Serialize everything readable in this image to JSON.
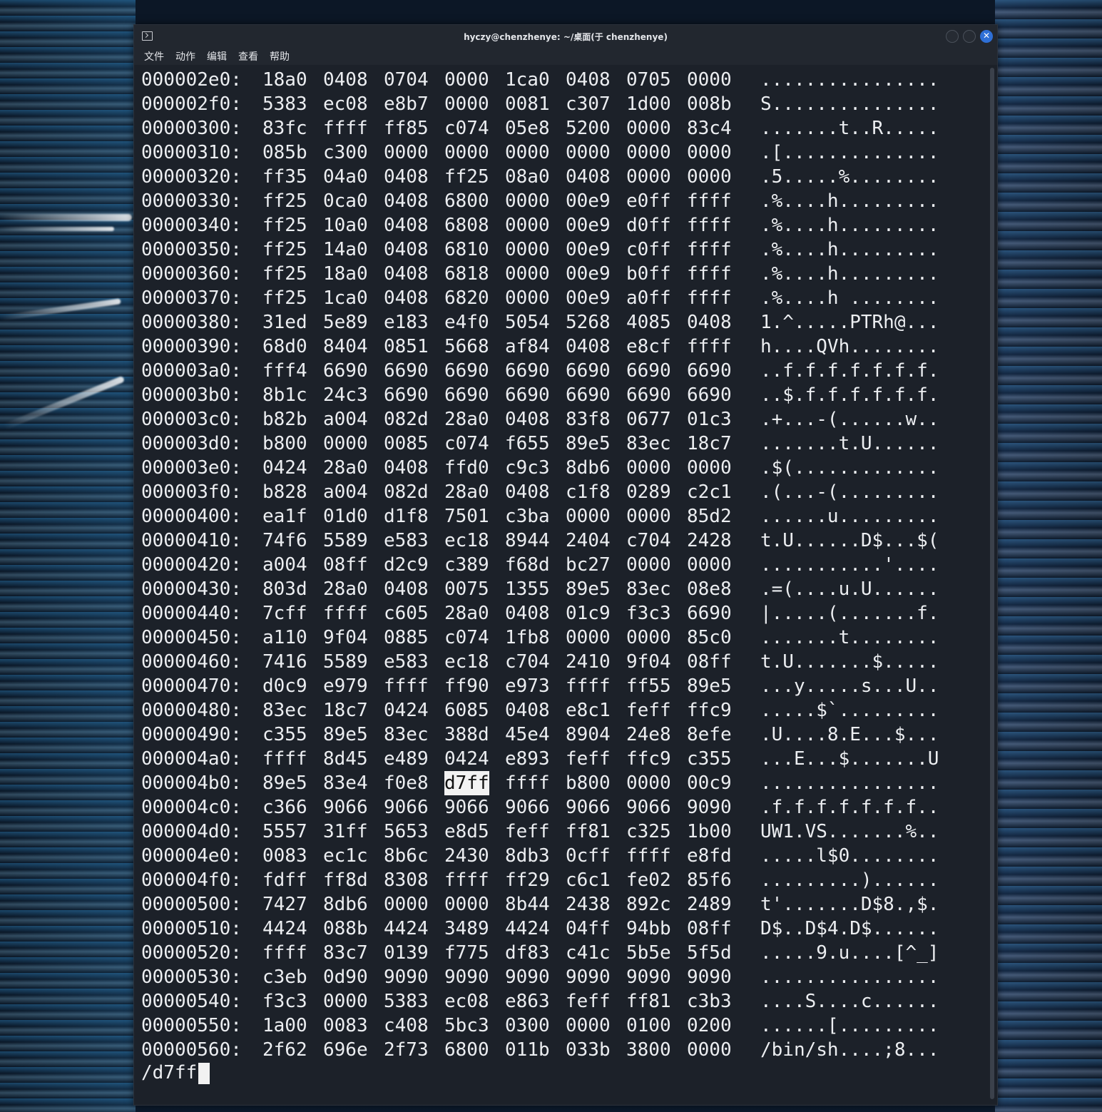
{
  "window": {
    "title": "hyczy@chenzhenye: ~/桌面(于 chenzhenye)",
    "close_glyph": "✕"
  },
  "menu": [
    "文件",
    "动作",
    "编辑",
    "查看",
    "帮助"
  ],
  "hexdump": [
    {
      "offset": "000002e0:",
      "words": [
        "18a0",
        "0408",
        "0704",
        "0000",
        "1ca0",
        "0408",
        "0705",
        "0000"
      ],
      "ascii": "................"
    },
    {
      "offset": "000002f0:",
      "words": [
        "5383",
        "ec08",
        "e8b7",
        "0000",
        "0081",
        "c307",
        "1d00",
        "008b"
      ],
      "ascii": "S..............."
    },
    {
      "offset": "00000300:",
      "words": [
        "83fc",
        "ffff",
        "ff85",
        "c074",
        "05e8",
        "5200",
        "0000",
        "83c4"
      ],
      "ascii": ".......t..R....."
    },
    {
      "offset": "00000310:",
      "words": [
        "085b",
        "c300",
        "0000",
        "0000",
        "0000",
        "0000",
        "0000",
        "0000"
      ],
      "ascii": ".[.............."
    },
    {
      "offset": "00000320:",
      "words": [
        "ff35",
        "04a0",
        "0408",
        "ff25",
        "08a0",
        "0408",
        "0000",
        "0000"
      ],
      "ascii": ".5.....%........"
    },
    {
      "offset": "00000330:",
      "words": [
        "ff25",
        "0ca0",
        "0408",
        "6800",
        "0000",
        "00e9",
        "e0ff",
        "ffff"
      ],
      "ascii": ".%....h........."
    },
    {
      "offset": "00000340:",
      "words": [
        "ff25",
        "10a0",
        "0408",
        "6808",
        "0000",
        "00e9",
        "d0ff",
        "ffff"
      ],
      "ascii": ".%....h........."
    },
    {
      "offset": "00000350:",
      "words": [
        "ff25",
        "14a0",
        "0408",
        "6810",
        "0000",
        "00e9",
        "c0ff",
        "ffff"
      ],
      "ascii": ".%....h........."
    },
    {
      "offset": "00000360:",
      "words": [
        "ff25",
        "18a0",
        "0408",
        "6818",
        "0000",
        "00e9",
        "b0ff",
        "ffff"
      ],
      "ascii": ".%....h........."
    },
    {
      "offset": "00000370:",
      "words": [
        "ff25",
        "1ca0",
        "0408",
        "6820",
        "0000",
        "00e9",
        "a0ff",
        "ffff"
      ],
      "ascii": ".%....h ........"
    },
    {
      "offset": "00000380:",
      "words": [
        "31ed",
        "5e89",
        "e183",
        "e4f0",
        "5054",
        "5268",
        "4085",
        "0408"
      ],
      "ascii": "1.^.....PTRh@..."
    },
    {
      "offset": "00000390:",
      "words": [
        "68d0",
        "8404",
        "0851",
        "5668",
        "af84",
        "0408",
        "e8cf",
        "ffff"
      ],
      "ascii": "h....QVh........"
    },
    {
      "offset": "000003a0:",
      "words": [
        "fff4",
        "6690",
        "6690",
        "6690",
        "6690",
        "6690",
        "6690",
        "6690"
      ],
      "ascii": "..f.f.f.f.f.f.f."
    },
    {
      "offset": "000003b0:",
      "words": [
        "8b1c",
        "24c3",
        "6690",
        "6690",
        "6690",
        "6690",
        "6690",
        "6690"
      ],
      "ascii": "..$.f.f.f.f.f.f."
    },
    {
      "offset": "000003c0:",
      "words": [
        "b82b",
        "a004",
        "082d",
        "28a0",
        "0408",
        "83f8",
        "0677",
        "01c3"
      ],
      "ascii": ".+...-(......w.."
    },
    {
      "offset": "000003d0:",
      "words": [
        "b800",
        "0000",
        "0085",
        "c074",
        "f655",
        "89e5",
        "83ec",
        "18c7"
      ],
      "ascii": ".......t.U......"
    },
    {
      "offset": "000003e0:",
      "words": [
        "0424",
        "28a0",
        "0408",
        "ffd0",
        "c9c3",
        "8db6",
        "0000",
        "0000"
      ],
      "ascii": ".$(............."
    },
    {
      "offset": "000003f0:",
      "words": [
        "b828",
        "a004",
        "082d",
        "28a0",
        "0408",
        "c1f8",
        "0289",
        "c2c1"
      ],
      "ascii": ".(...-(........."
    },
    {
      "offset": "00000400:",
      "words": [
        "ea1f",
        "01d0",
        "d1f8",
        "7501",
        "c3ba",
        "0000",
        "0000",
        "85d2"
      ],
      "ascii": "......u........."
    },
    {
      "offset": "00000410:",
      "words": [
        "74f6",
        "5589",
        "e583",
        "ec18",
        "8944",
        "2404",
        "c704",
        "2428"
      ],
      "ascii": "t.U......D$...$("
    },
    {
      "offset": "00000420:",
      "words": [
        "a004",
        "08ff",
        "d2c9",
        "c389",
        "f68d",
        "bc27",
        "0000",
        "0000"
      ],
      "ascii": "...........'...."
    },
    {
      "offset": "00000430:",
      "words": [
        "803d",
        "28a0",
        "0408",
        "0075",
        "1355",
        "89e5",
        "83ec",
        "08e8"
      ],
      "ascii": ".=(....u.U......"
    },
    {
      "offset": "00000440:",
      "words": [
        "7cff",
        "ffff",
        "c605",
        "28a0",
        "0408",
        "01c9",
        "f3c3",
        "6690"
      ],
      "ascii": "|.....(.......f."
    },
    {
      "offset": "00000450:",
      "words": [
        "a110",
        "9f04",
        "0885",
        "c074",
        "1fb8",
        "0000",
        "0000",
        "85c0"
      ],
      "ascii": ".......t........"
    },
    {
      "offset": "00000460:",
      "words": [
        "7416",
        "5589",
        "e583",
        "ec18",
        "c704",
        "2410",
        "9f04",
        "08ff"
      ],
      "ascii": "t.U.......$....."
    },
    {
      "offset": "00000470:",
      "words": [
        "d0c9",
        "e979",
        "ffff",
        "ff90",
        "e973",
        "ffff",
        "ff55",
        "89e5"
      ],
      "ascii": "...y.....s...U.."
    },
    {
      "offset": "00000480:",
      "words": [
        "83ec",
        "18c7",
        "0424",
        "6085",
        "0408",
        "e8c1",
        "feff",
        "ffc9"
      ],
      "ascii": ".....$`........."
    },
    {
      "offset": "00000490:",
      "words": [
        "c355",
        "89e5",
        "83ec",
        "388d",
        "45e4",
        "8904",
        "24e8",
        "8efe"
      ],
      "ascii": ".U....8.E...$..."
    },
    {
      "offset": "000004a0:",
      "words": [
        "ffff",
        "8d45",
        "e489",
        "0424",
        "e893",
        "feff",
        "ffc9",
        "c355"
      ],
      "ascii": "...E...$.......U"
    },
    {
      "offset": "000004b0:",
      "words": [
        "89e5",
        "83e4",
        "f0e8",
        "d7ff",
        "ffff",
        "b800",
        "0000",
        "00c9"
      ],
      "ascii": "................"
    },
    {
      "offset": "000004c0:",
      "words": [
        "c366",
        "9066",
        "9066",
        "9066",
        "9066",
        "9066",
        "9066",
        "9090"
      ],
      "ascii": ".f.f.f.f.f.f.f.."
    },
    {
      "offset": "000004d0:",
      "words": [
        "5557",
        "31ff",
        "5653",
        "e8d5",
        "feff",
        "ff81",
        "c325",
        "1b00"
      ],
      "ascii": "UW1.VS.......%.."
    },
    {
      "offset": "000004e0:",
      "words": [
        "0083",
        "ec1c",
        "8b6c",
        "2430",
        "8db3",
        "0cff",
        "ffff",
        "e8fd"
      ],
      "ascii": ".....l$0........"
    },
    {
      "offset": "000004f0:",
      "words": [
        "fdff",
        "ff8d",
        "8308",
        "ffff",
        "ff29",
        "c6c1",
        "fe02",
        "85f6"
      ],
      "ascii": ".........)......"
    },
    {
      "offset": "00000500:",
      "words": [
        "7427",
        "8db6",
        "0000",
        "0000",
        "8b44",
        "2438",
        "892c",
        "2489"
      ],
      "ascii": "t'.......D$8.,$."
    },
    {
      "offset": "00000510:",
      "words": [
        "4424",
        "088b",
        "4424",
        "3489",
        "4424",
        "04ff",
        "94bb",
        "08ff"
      ],
      "ascii": "D$..D$4.D$......"
    },
    {
      "offset": "00000520:",
      "words": [
        "ffff",
        "83c7",
        "0139",
        "f775",
        "df83",
        "c41c",
        "5b5e",
        "5f5d"
      ],
      "ascii": ".....9.u....[^_]"
    },
    {
      "offset": "00000530:",
      "words": [
        "c3eb",
        "0d90",
        "9090",
        "9090",
        "9090",
        "9090",
        "9090",
        "9090"
      ],
      "ascii": "................"
    },
    {
      "offset": "00000540:",
      "words": [
        "f3c3",
        "0000",
        "5383",
        "ec08",
        "e863",
        "feff",
        "ff81",
        "c3b3"
      ],
      "ascii": "....S....c......"
    },
    {
      "offset": "00000550:",
      "words": [
        "1a00",
        "0083",
        "c408",
        "5bc3",
        "0300",
        "0000",
        "0100",
        "0200"
      ],
      "ascii": "......[........."
    },
    {
      "offset": "00000560:",
      "words": [
        "2f62",
        "696e",
        "2f73",
        "6800",
        "011b",
        "033b",
        "3800",
        "0000"
      ],
      "ascii": "/bin/sh....;8..."
    }
  ],
  "highlight": {
    "row": 29,
    "word": 3
  },
  "prompt": "/d7ff"
}
